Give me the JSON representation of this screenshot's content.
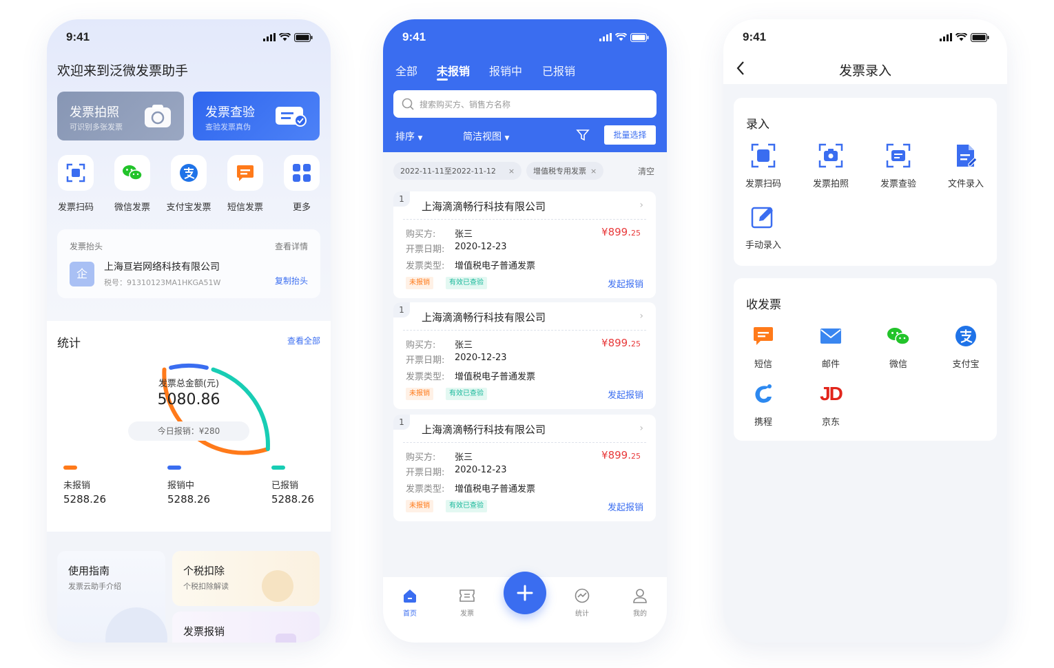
{
  "status_time": "9:41",
  "home": {
    "welcome": "欢迎来到泛微发票助手",
    "photo": {
      "title": "发票拍照",
      "sub": "可识别多张发票"
    },
    "verify": {
      "title": "发票查验",
      "sub": "查验发票真伪"
    },
    "quick": [
      {
        "label": "发票扫码",
        "icon": "scan-icon"
      },
      {
        "label": "微信发票",
        "icon": "wechat-icon"
      },
      {
        "label": "支付宝发票",
        "icon": "alipay-icon"
      },
      {
        "label": "短信发票",
        "icon": "sms-icon"
      },
      {
        "label": "更多",
        "icon": "grid-icon"
      }
    ],
    "header_card": {
      "label": "发票抬头",
      "detail": "查看详情",
      "avatar": "企",
      "company": "上海亘岩网络科技有限公司",
      "tax": "税号：91310123MA1HKGA51W",
      "copy": "复制抬头"
    },
    "stats": {
      "title": "统计",
      "view_all": "查看全部",
      "gauge_label": "发票总金额(元)",
      "total": "5080.86",
      "today": "今日报销：¥280",
      "items": [
        {
          "label": "未报销",
          "value": "5288.26",
          "color": "#ff7a1a"
        },
        {
          "label": "报销中",
          "value": "5288.26",
          "color": "#3a6df0"
        },
        {
          "label": "已报销",
          "value": "5288.26",
          "color": "#18cdb4"
        }
      ],
      "gauge_colors": [
        "#ff7a1a",
        "#3a6df0",
        "#18cdb4"
      ]
    },
    "guide": {
      "title": "使用指南",
      "sub": "发票云助手介绍"
    },
    "tax": {
      "title": "个税扣除",
      "sub": "个税扣除解读"
    },
    "reimb": {
      "title": "发票报销"
    }
  },
  "list": {
    "tabs": [
      "全部",
      "未报销",
      "报销中",
      "已报销"
    ],
    "active_tab": 1,
    "search_placeholder": "搜索购买方、销售方名称",
    "sort": "排序",
    "view": "简洁视图",
    "batch": "批量选择",
    "filters": [
      "2022-11-11至2022-11-12",
      "增值税专用发票"
    ],
    "clear": "清空",
    "invoices": [
      {
        "no": "1",
        "company": "上海滴滴畅行科技有限公司",
        "buyer_k": "购买方:",
        "buyer": "张三",
        "date_k": "开票日期:",
        "date": "2020-12-23",
        "type_k": "发票类型:",
        "type": "增值税电子普通发票",
        "amount": "¥899.",
        "cents": "25",
        "tag1": "未报销",
        "tag2": "有效已查验",
        "action": "发起报销"
      },
      {
        "no": "1",
        "company": "上海滴滴畅行科技有限公司",
        "buyer_k": "购买方:",
        "buyer": "张三",
        "date_k": "开票日期:",
        "date": "2020-12-23",
        "type_k": "发票类型:",
        "type": "增值税电子普通发票",
        "amount": "¥899.",
        "cents": "25",
        "tag1": "未报销",
        "tag2": "有效已查验",
        "action": "发起报销"
      },
      {
        "no": "1",
        "company": "上海滴滴畅行科技有限公司",
        "buyer_k": "购买方:",
        "buyer": "张三",
        "date_k": "开票日期:",
        "date": "2020-12-23",
        "type_k": "发票类型:",
        "type": "增值税电子普通发票",
        "amount": "¥899.",
        "cents": "25",
        "tag1": "未报销",
        "tag2": "有效已查验",
        "action": "发起报销"
      }
    ],
    "nav": [
      {
        "label": "首页",
        "icon": "home-icon"
      },
      {
        "label": "发票",
        "icon": "ticket-icon"
      },
      {
        "label": "统计",
        "icon": "chart-icon"
      },
      {
        "label": "我的",
        "icon": "user-icon"
      }
    ],
    "accent": "#3a6df0"
  },
  "entry": {
    "title": "发票录入",
    "input_title": "录入",
    "input_items": [
      {
        "label": "发票扫码",
        "icon": "scan-icon"
      },
      {
        "label": "发票拍照",
        "icon": "camera-icon"
      },
      {
        "label": "发票查验",
        "icon": "verify-icon"
      },
      {
        "label": "文件录入",
        "icon": "file-icon"
      },
      {
        "label": "手动录入",
        "icon": "edit-icon"
      }
    ],
    "receive_title": "收发票",
    "receive_items": [
      {
        "label": "短信",
        "icon": "sms-icon"
      },
      {
        "label": "邮件",
        "icon": "mail-icon"
      },
      {
        "label": "微信",
        "icon": "wechat-icon"
      },
      {
        "label": "支付宝",
        "icon": "alipay-icon"
      },
      {
        "label": "携程",
        "icon": "ctrip-icon"
      },
      {
        "label": "京东",
        "icon": "jd-icon"
      }
    ],
    "jd_mark": "JD"
  }
}
